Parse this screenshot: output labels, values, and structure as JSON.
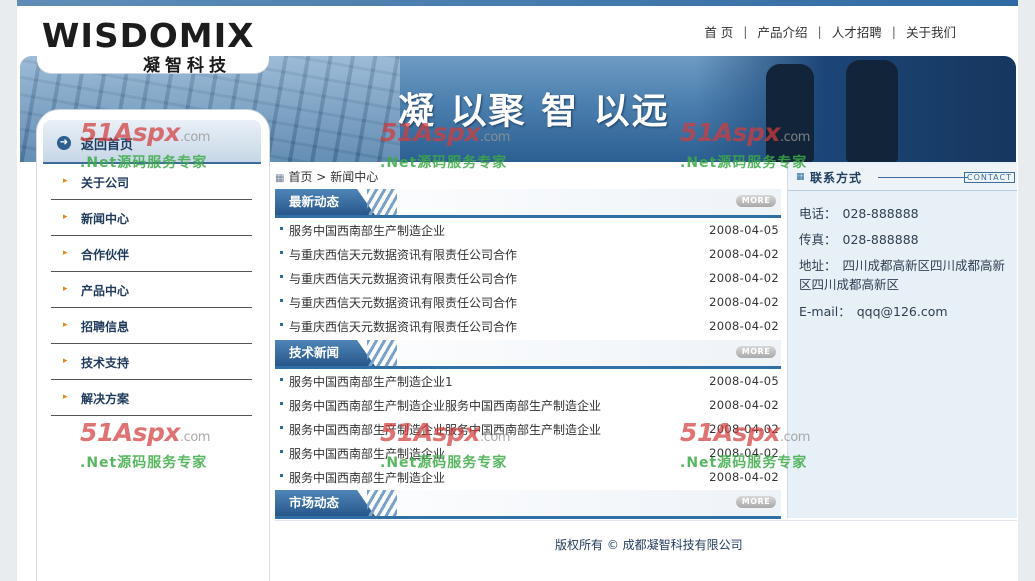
{
  "logo": {
    "brand": "WISDOMIX",
    "subtitle": "凝智科技"
  },
  "nav": {
    "items": [
      "首 页",
      "产品介绍",
      "人才招聘",
      "关于我们"
    ]
  },
  "banner": {
    "slogan": "凝 以聚  智 以远"
  },
  "sidebar": {
    "home_label": "返回首页",
    "items": [
      "关于公司",
      "新闻中心",
      "合作伙伴",
      "产品中心",
      "招聘信息",
      "技术支持",
      "解决方案"
    ]
  },
  "breadcrumb": {
    "home": "首页",
    "sep": ">",
    "current": "新闻中心"
  },
  "sections": {
    "latest": {
      "title": "最新动态",
      "more": "MORE",
      "items": [
        {
          "title": "服务中国西南部生产制造企业",
          "date": "2008-04-05"
        },
        {
          "title": "与重庆西信天元数据资讯有限责任公司合作",
          "date": "2008-04-02"
        },
        {
          "title": "与重庆西信天元数据资讯有限责任公司合作",
          "date": "2008-04-02"
        },
        {
          "title": "与重庆西信天元数据资讯有限责任公司合作",
          "date": "2008-04-02"
        },
        {
          "title": "与重庆西信天元数据资讯有限责任公司合作",
          "date": "2008-04-02"
        }
      ]
    },
    "tech": {
      "title": "技术新闻",
      "more": "MORE",
      "items": [
        {
          "title": "服务中国西南部生产制造企业1",
          "date": "2008-04-05"
        },
        {
          "title": "服务中国西南部生产制造企业服务中国西南部生产制造企业",
          "date": "2008-04-02"
        },
        {
          "title": "服务中国西南部生产制造企业服务中国西南部生产制造企业",
          "date": "2008-04-02"
        },
        {
          "title": "服务中国西南部生产制造企业",
          "date": "2008-04-02"
        },
        {
          "title": "服务中国西南部生产制造企业",
          "date": "2008-04-02"
        }
      ]
    },
    "market": {
      "title": "市场动态",
      "more": "MORE"
    }
  },
  "contact": {
    "title": "联系方式",
    "title_en": "CONTACT",
    "phone_label": "电话：",
    "phone": "028-888888",
    "fax_label": "传真：",
    "fax": "028-888888",
    "address_label": "地址：",
    "address": "四川成都高新区四川成都高新区四川成都高新区",
    "email_label": "E-mail：",
    "email": "qqq@126.com"
  },
  "footer": {
    "copyright": "版权所有 © 成都凝智科技有限公司"
  },
  "watermark": {
    "brand": "51Aspx",
    "domain": ".com",
    "tagline": ".Net源码服务专家"
  },
  "colors": {
    "accent": "#2f6fa5",
    "nav_dark": "#1f3a5c",
    "watermark_red": "#d23c3c",
    "watermark_green": "#3caa46"
  }
}
